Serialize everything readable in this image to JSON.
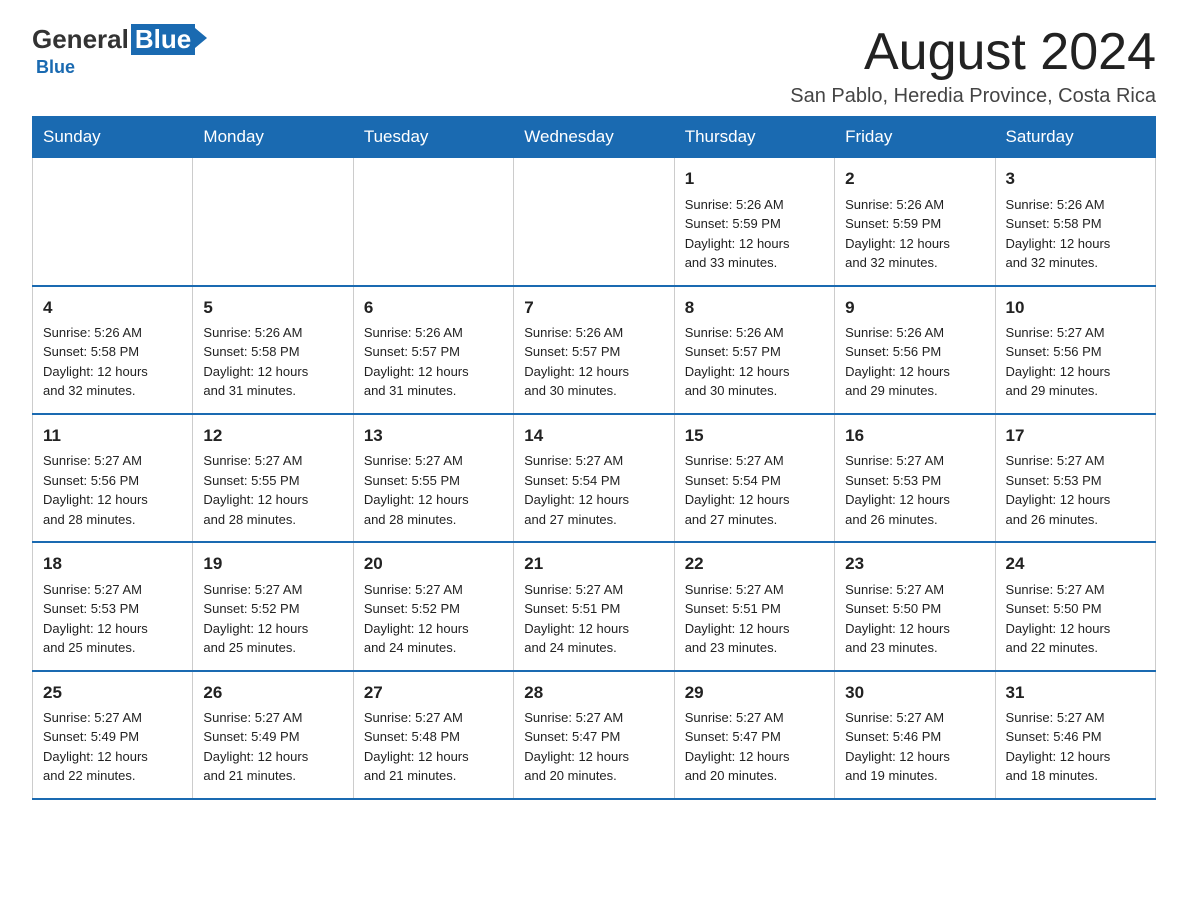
{
  "header": {
    "logo_general": "General",
    "logo_blue": "Blue",
    "month_title": "August 2024",
    "location": "San Pablo, Heredia Province, Costa Rica"
  },
  "weekdays": [
    "Sunday",
    "Monday",
    "Tuesday",
    "Wednesday",
    "Thursday",
    "Friday",
    "Saturday"
  ],
  "weeks": [
    [
      {
        "day": "",
        "info": ""
      },
      {
        "day": "",
        "info": ""
      },
      {
        "day": "",
        "info": ""
      },
      {
        "day": "",
        "info": ""
      },
      {
        "day": "1",
        "info": "Sunrise: 5:26 AM\nSunset: 5:59 PM\nDaylight: 12 hours\nand 33 minutes."
      },
      {
        "day": "2",
        "info": "Sunrise: 5:26 AM\nSunset: 5:59 PM\nDaylight: 12 hours\nand 32 minutes."
      },
      {
        "day": "3",
        "info": "Sunrise: 5:26 AM\nSunset: 5:58 PM\nDaylight: 12 hours\nand 32 minutes."
      }
    ],
    [
      {
        "day": "4",
        "info": "Sunrise: 5:26 AM\nSunset: 5:58 PM\nDaylight: 12 hours\nand 32 minutes."
      },
      {
        "day": "5",
        "info": "Sunrise: 5:26 AM\nSunset: 5:58 PM\nDaylight: 12 hours\nand 31 minutes."
      },
      {
        "day": "6",
        "info": "Sunrise: 5:26 AM\nSunset: 5:57 PM\nDaylight: 12 hours\nand 31 minutes."
      },
      {
        "day": "7",
        "info": "Sunrise: 5:26 AM\nSunset: 5:57 PM\nDaylight: 12 hours\nand 30 minutes."
      },
      {
        "day": "8",
        "info": "Sunrise: 5:26 AM\nSunset: 5:57 PM\nDaylight: 12 hours\nand 30 minutes."
      },
      {
        "day": "9",
        "info": "Sunrise: 5:26 AM\nSunset: 5:56 PM\nDaylight: 12 hours\nand 29 minutes."
      },
      {
        "day": "10",
        "info": "Sunrise: 5:27 AM\nSunset: 5:56 PM\nDaylight: 12 hours\nand 29 minutes."
      }
    ],
    [
      {
        "day": "11",
        "info": "Sunrise: 5:27 AM\nSunset: 5:56 PM\nDaylight: 12 hours\nand 28 minutes."
      },
      {
        "day": "12",
        "info": "Sunrise: 5:27 AM\nSunset: 5:55 PM\nDaylight: 12 hours\nand 28 minutes."
      },
      {
        "day": "13",
        "info": "Sunrise: 5:27 AM\nSunset: 5:55 PM\nDaylight: 12 hours\nand 28 minutes."
      },
      {
        "day": "14",
        "info": "Sunrise: 5:27 AM\nSunset: 5:54 PM\nDaylight: 12 hours\nand 27 minutes."
      },
      {
        "day": "15",
        "info": "Sunrise: 5:27 AM\nSunset: 5:54 PM\nDaylight: 12 hours\nand 27 minutes."
      },
      {
        "day": "16",
        "info": "Sunrise: 5:27 AM\nSunset: 5:53 PM\nDaylight: 12 hours\nand 26 minutes."
      },
      {
        "day": "17",
        "info": "Sunrise: 5:27 AM\nSunset: 5:53 PM\nDaylight: 12 hours\nand 26 minutes."
      }
    ],
    [
      {
        "day": "18",
        "info": "Sunrise: 5:27 AM\nSunset: 5:53 PM\nDaylight: 12 hours\nand 25 minutes."
      },
      {
        "day": "19",
        "info": "Sunrise: 5:27 AM\nSunset: 5:52 PM\nDaylight: 12 hours\nand 25 minutes."
      },
      {
        "day": "20",
        "info": "Sunrise: 5:27 AM\nSunset: 5:52 PM\nDaylight: 12 hours\nand 24 minutes."
      },
      {
        "day": "21",
        "info": "Sunrise: 5:27 AM\nSunset: 5:51 PM\nDaylight: 12 hours\nand 24 minutes."
      },
      {
        "day": "22",
        "info": "Sunrise: 5:27 AM\nSunset: 5:51 PM\nDaylight: 12 hours\nand 23 minutes."
      },
      {
        "day": "23",
        "info": "Sunrise: 5:27 AM\nSunset: 5:50 PM\nDaylight: 12 hours\nand 23 minutes."
      },
      {
        "day": "24",
        "info": "Sunrise: 5:27 AM\nSunset: 5:50 PM\nDaylight: 12 hours\nand 22 minutes."
      }
    ],
    [
      {
        "day": "25",
        "info": "Sunrise: 5:27 AM\nSunset: 5:49 PM\nDaylight: 12 hours\nand 22 minutes."
      },
      {
        "day": "26",
        "info": "Sunrise: 5:27 AM\nSunset: 5:49 PM\nDaylight: 12 hours\nand 21 minutes."
      },
      {
        "day": "27",
        "info": "Sunrise: 5:27 AM\nSunset: 5:48 PM\nDaylight: 12 hours\nand 21 minutes."
      },
      {
        "day": "28",
        "info": "Sunrise: 5:27 AM\nSunset: 5:47 PM\nDaylight: 12 hours\nand 20 minutes."
      },
      {
        "day": "29",
        "info": "Sunrise: 5:27 AM\nSunset: 5:47 PM\nDaylight: 12 hours\nand 20 minutes."
      },
      {
        "day": "30",
        "info": "Sunrise: 5:27 AM\nSunset: 5:46 PM\nDaylight: 12 hours\nand 19 minutes."
      },
      {
        "day": "31",
        "info": "Sunrise: 5:27 AM\nSunset: 5:46 PM\nDaylight: 12 hours\nand 18 minutes."
      }
    ]
  ]
}
